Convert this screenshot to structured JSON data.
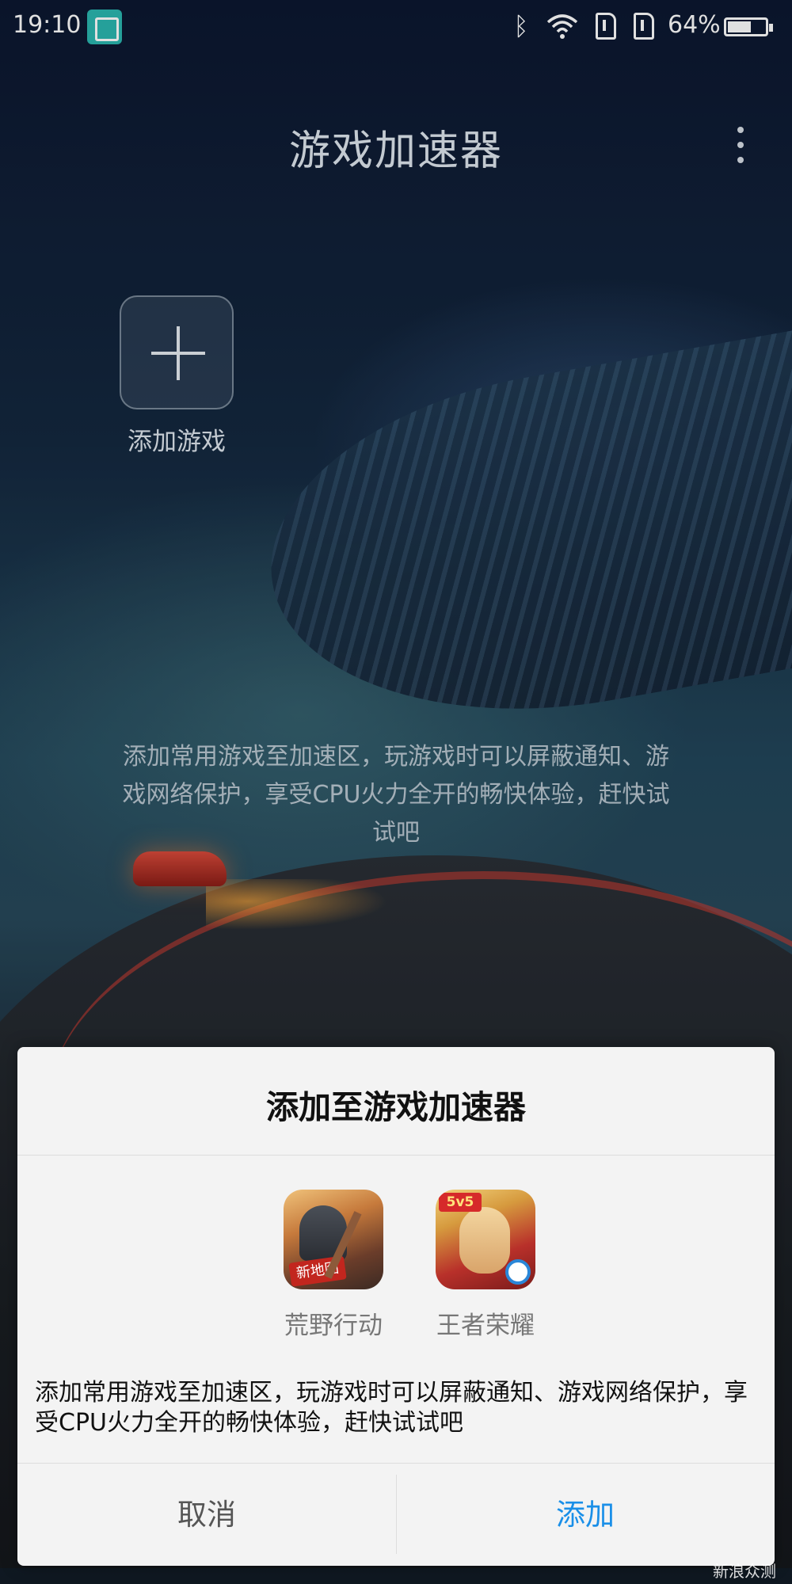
{
  "status_bar": {
    "time": "19:10",
    "icons": [
      "screenshot-icon",
      "bluetooth-icon",
      "wifi-icon",
      "sim-card-icon",
      "sim-card-icon",
      "battery-icon"
    ],
    "battery_percent": "64%",
    "battery_level": 0.64
  },
  "header": {
    "title": "游戏加速器",
    "more_icon": "more-vertical-icon"
  },
  "main": {
    "add_game_label": "添加游戏",
    "add_icon": "plus-icon",
    "description": "添加常用游戏至加速区，玩游戏时可以屏蔽通知、游戏网络保护，享受CPU火力全开的畅快体验，赶快试试吧"
  },
  "dialog": {
    "title": "添加至游戏加速器",
    "apps": [
      {
        "label": "荒野行动",
        "badge": "新地图"
      },
      {
        "label": "王者荣耀",
        "badge": "5v5"
      }
    ],
    "description": "添加常用游戏至加速区，玩游戏时可以屏蔽通知、游戏网络保护，享受CPU火力全开的畅快体验，赶快试试吧",
    "cancel_label": "取消",
    "add_label": "添加"
  },
  "colors": {
    "accent": "#1a8fe8",
    "dialog_bg": "#f3f3f3"
  },
  "watermark": "新浪众测"
}
